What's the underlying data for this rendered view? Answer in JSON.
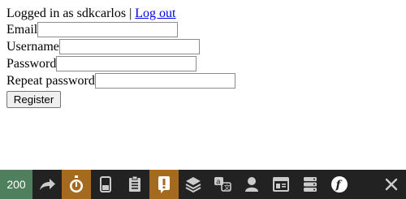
{
  "session": {
    "logged_in_text": "Logged in as sdkcarlos",
    "separator": "|",
    "logout_link": "Log out"
  },
  "form": {
    "email_label": "Email",
    "email_value": "",
    "username_label": "Username",
    "username_value": "",
    "password_label": "Password",
    "password_value": "",
    "repeat_password_label": "Repeat password",
    "repeat_password_value": "",
    "register_button": "Register"
  },
  "toolbar": {
    "status_code": "200",
    "items": [
      {
        "icon": "redirect-icon"
      },
      {
        "icon": "timer-icon",
        "highlight": "warning"
      },
      {
        "icon": "memory-icon"
      },
      {
        "icon": "clipboard-icon"
      },
      {
        "icon": "alert-icon",
        "highlight": "warning"
      },
      {
        "icon": "layers-icon"
      },
      {
        "icon": "translation-icon"
      },
      {
        "icon": "user-icon"
      },
      {
        "icon": "template-icon"
      },
      {
        "icon": "database-icon"
      },
      {
        "icon": "symfony-icon"
      }
    ],
    "close_icon": "close-icon",
    "colors": {
      "background": "#222222",
      "status_ok": "#4f805d",
      "warning": "#a46a1f",
      "icon": "#cccccc"
    }
  }
}
